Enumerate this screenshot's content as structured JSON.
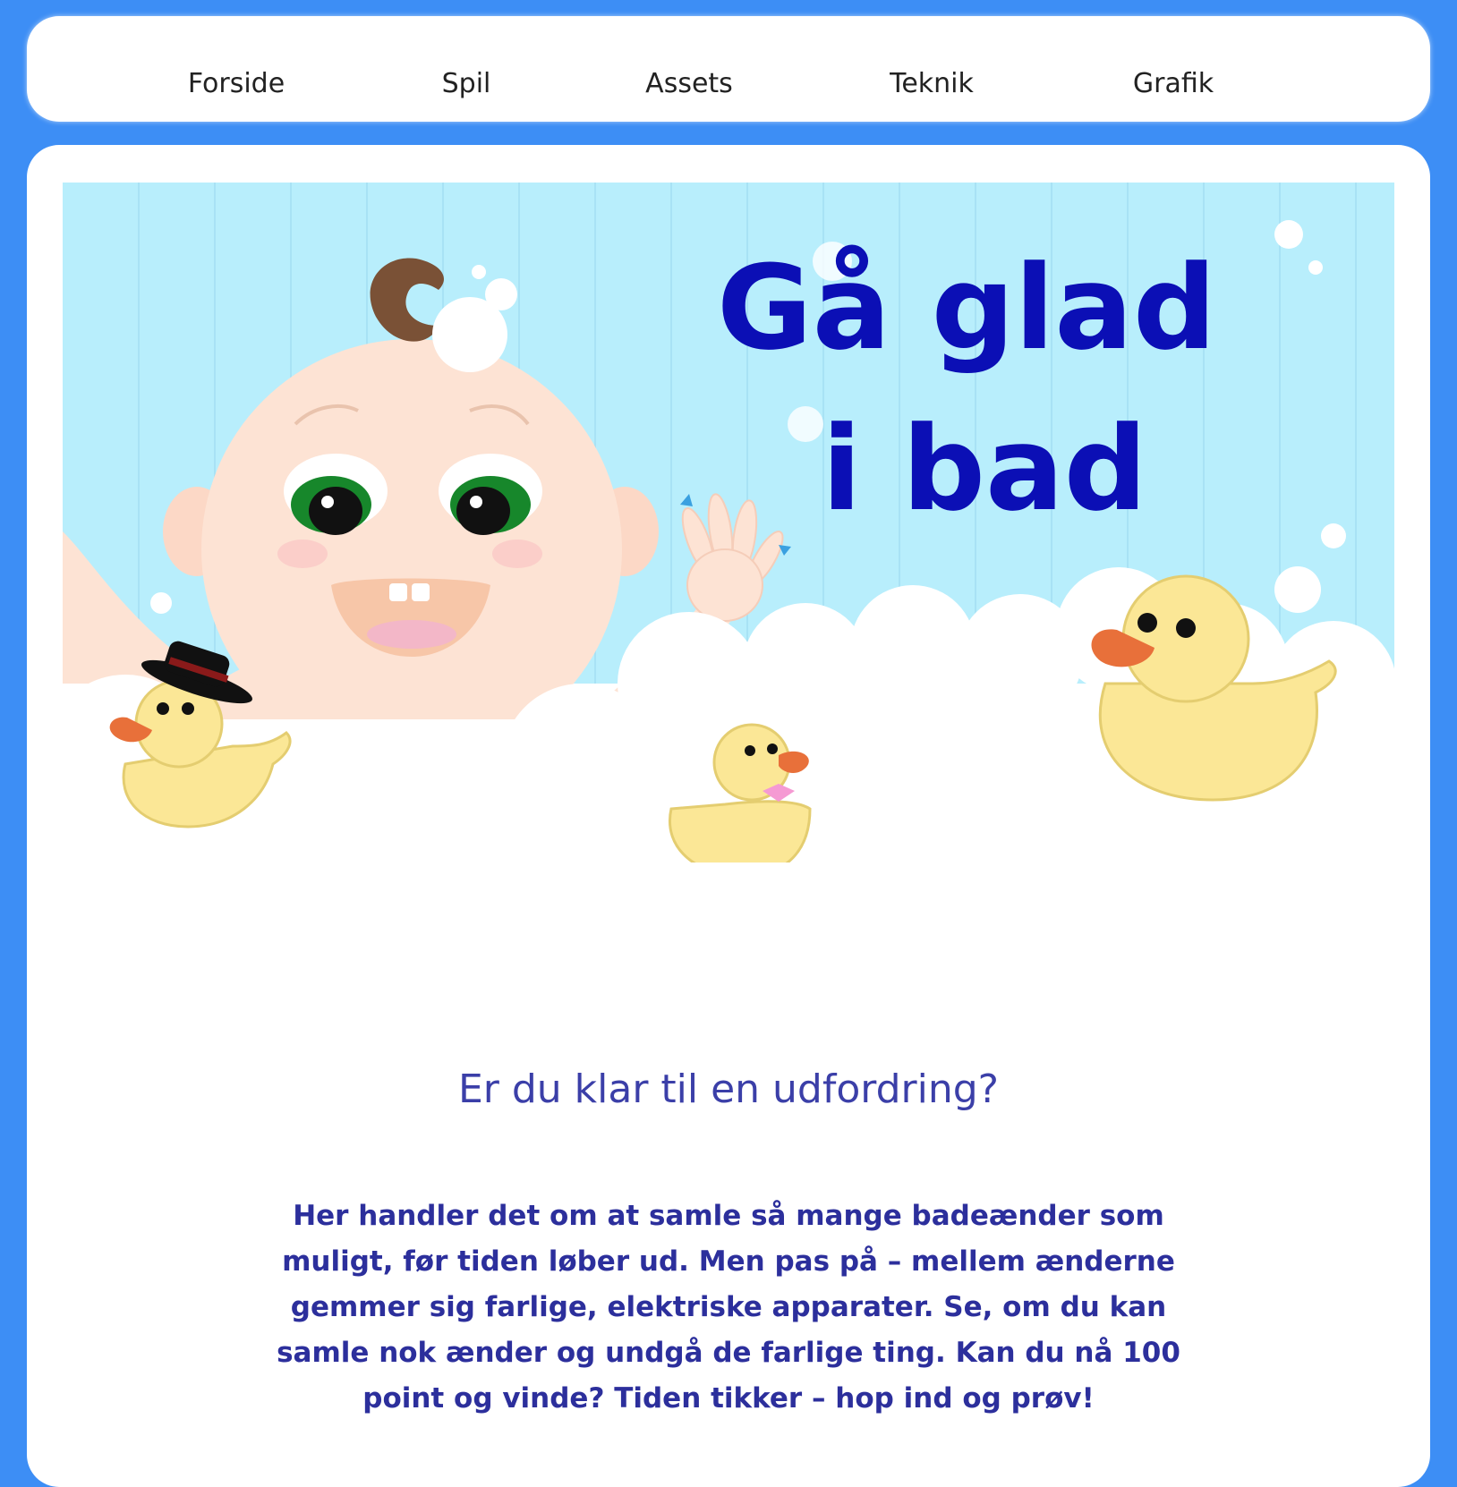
{
  "nav": {
    "items": [
      {
        "label": "Forside"
      },
      {
        "label": "Spil"
      },
      {
        "label": "Assets"
      },
      {
        "label": "Teknik"
      },
      {
        "label": "Grafik"
      }
    ]
  },
  "hero": {
    "title_line1": "Gå glad",
    "title_line2": "i bad"
  },
  "main": {
    "heading": "Er du klar til en udfordring?",
    "body": "Her handler det om at samle så mange badeænder som muligt, før tiden løber ud. Men pas på – mellem ænderne gemmer sig farlige, elektriske apparater. Se, om du kan samle nok ænder og undgå de farlige ting. Kan du nå 100 point og vinde? Tiden tikker – hop ind og prøv!"
  },
  "colors": {
    "page_background": "#3d8ef5",
    "title": "#0b0fb5",
    "heading": "#3b3fa8",
    "body_text": "#2c2f9c",
    "sky": "#b8eefc"
  },
  "icons": [
    "baby-illustration",
    "duck-with-hat-icon",
    "small-duck-icon",
    "big-duck-icon",
    "bubbles"
  ]
}
